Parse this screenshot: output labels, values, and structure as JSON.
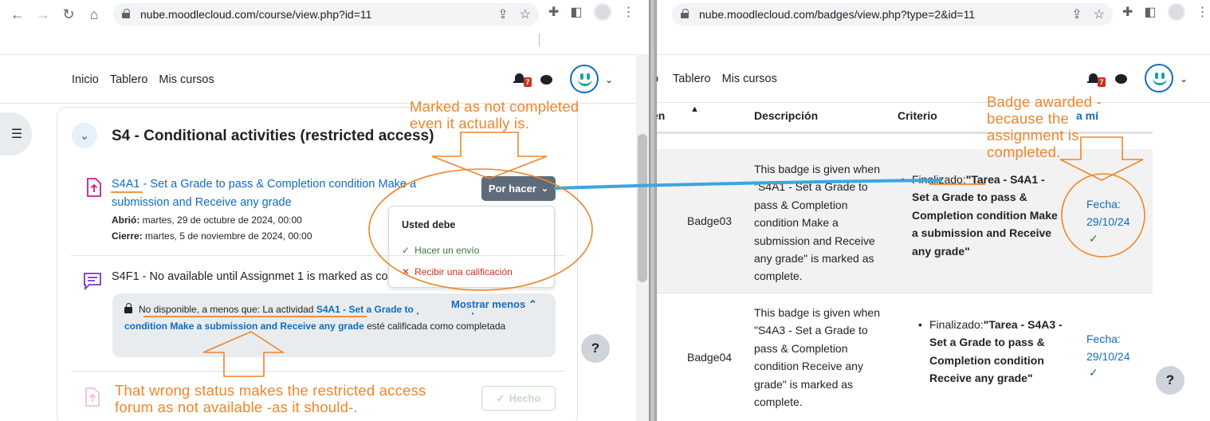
{
  "left_window": {
    "url": "nube.moodlecloud.com/course/view.php?id=11",
    "nav_links": [
      "Inicio",
      "Tablero",
      "Mis cursos"
    ],
    "notification_count": "7",
    "section_title": "S4 - Conditional activities (restricted access)",
    "activity1": {
      "title": "S4A1 - Set a Grade to pass & Completion condition Make a submission and Receive any grade",
      "opened_label": "Abrió:",
      "opened_value": "martes, 29 de octubre de 2024, 00:00",
      "closed_label": "Cierre:",
      "closed_value": "martes, 5 de noviembre de 2024, 00:00",
      "status_button": "Por hacer",
      "popover": {
        "title": "Usted debe",
        "items": [
          "Hacer un envío",
          "Recibir una calificación"
        ]
      }
    },
    "activity2": {
      "title": "S4F1 - No available until Assignmet 1 is marked as co",
      "restriction_prefix": "No disponible, a menos que: La actividad",
      "restriction_link": "S4A1 - Set a Grade to pass & Completion condition Make a submission and Receive any grade",
      "restriction_suffix": "esté calificada como completada",
      "show_less": "Mostrar menos"
    },
    "activity3": {
      "status_button": "Hecho"
    },
    "help": "?"
  },
  "right_window": {
    "url": "nube.moodlecloud.com/badges/view.php?type=2&id=11",
    "nav_links": [
      "Tablero",
      "Mis cursos"
    ],
    "nav_partial": "o",
    "notification_count": "7",
    "columns": {
      "name_partial": "en",
      "description": "Descripción",
      "criteria": "Criterio",
      "issued_partial": "a mí"
    },
    "rows": [
      {
        "name": "Badge03",
        "description": "This badge is given when \"S4A1 - Set a Grade to pass & Completion condition Make a submission and Receive any grade\" is marked as complete.",
        "criteria_prefix": "Finalizado:",
        "criteria_bold": "\"Tarea - S4A1 - Set a Grade to pass & Completion condition Make a submission and Receive any grade\"",
        "issued": "Fecha: 29/10/24"
      },
      {
        "name": "Badge04",
        "description": "This badge is given when \"S4A3 - Set a Grade to pass & Completion condition Receive any grade\" is marked as complete.",
        "criteria_prefix": "Finalizado:",
        "criteria_bold": "\"Tarea - S4A3 - Set a Grade to pass & Completion condition Receive any grade\"",
        "issued": "Fecha: 29/10/24"
      }
    ],
    "help": "?"
  },
  "annotations": {
    "top_left": "Marked as not completed even it actually is.",
    "bottom_left": "That wrong status makes the restricted access forum as not available -as it should-.",
    "top_right": "Badge awarded - because the assignment is completed."
  },
  "colors": {
    "annotation": "#f0852a",
    "link": "#0f6cbf",
    "connector": "#3aa6e0",
    "status_button": "#5e6c7a"
  }
}
